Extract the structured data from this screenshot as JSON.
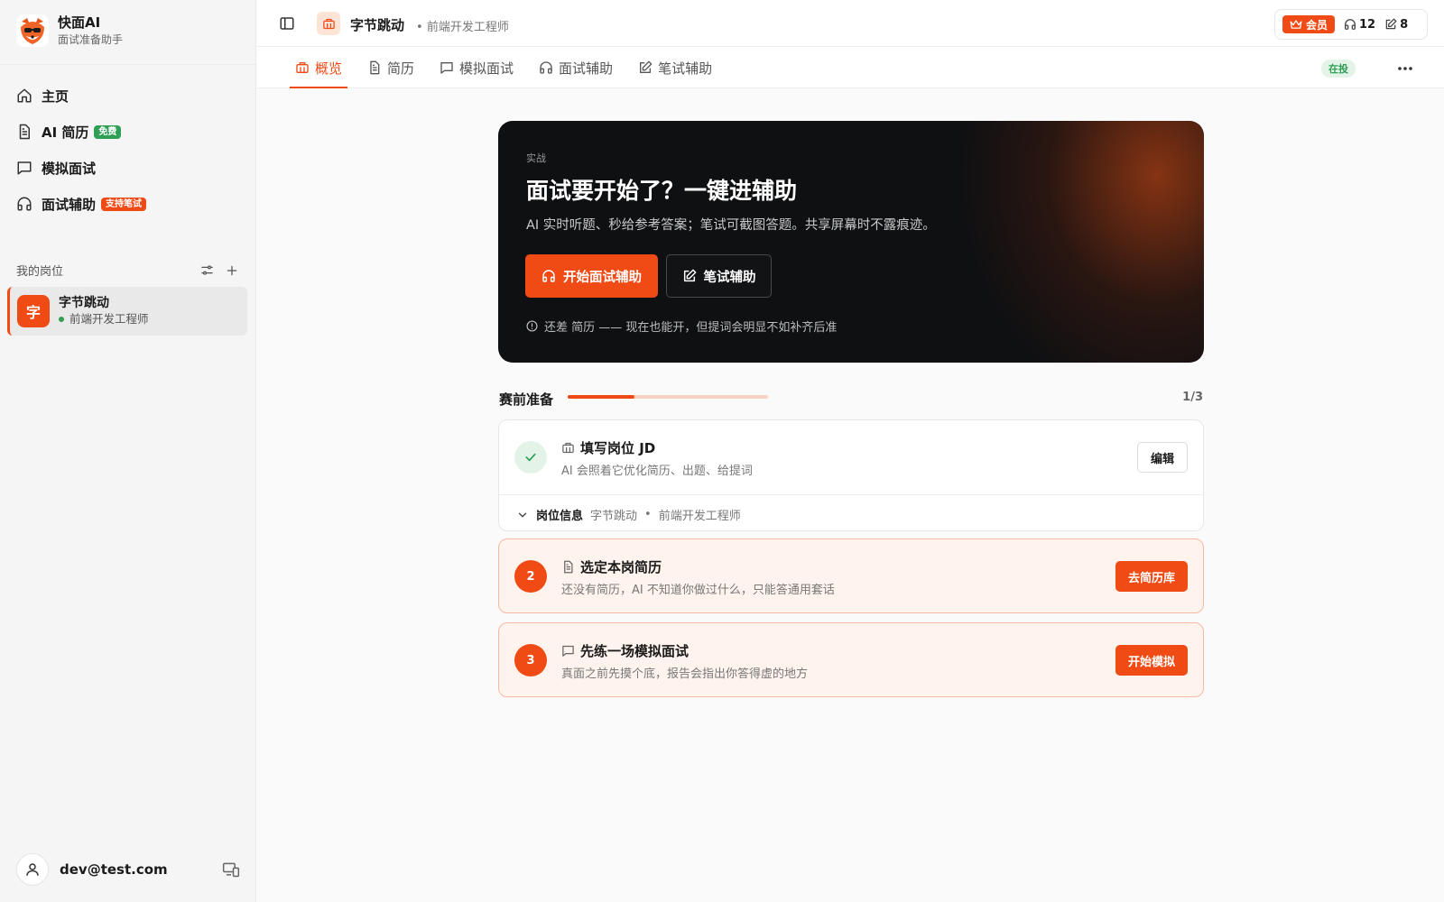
{
  "app": {
    "name": "快面AI",
    "subtitle": "面试准备助手"
  },
  "sidebar": {
    "nav": [
      {
        "label": "主页",
        "icon": "home-icon"
      },
      {
        "label": "AI 简历",
        "icon": "document-icon",
        "badge": "免费",
        "badge_color": "#2e9f55"
      },
      {
        "label": "模拟面试",
        "icon": "chat-bubble-icon"
      },
      {
        "label": "面试辅助",
        "icon": "headphones-icon",
        "badge": "支持笔试",
        "badge_color": "#f04a15"
      }
    ],
    "section_title": "我的岗位",
    "jobs": [
      {
        "avatar": "字",
        "company": "字节跳动",
        "role": "前端开发工程师",
        "status_color": "#2e9f55"
      }
    ],
    "user_email": "dev@test.com"
  },
  "topbar": {
    "company": "字节跳动",
    "role": "前端开发工程师",
    "vip_label": "会员",
    "interview_quota": "12",
    "written_quota": "8"
  },
  "tabs": [
    {
      "label": "概览",
      "icon": "briefcase-icon",
      "active": true
    },
    {
      "label": "简历",
      "icon": "document-icon"
    },
    {
      "label": "模拟面试",
      "icon": "chat-bubble-icon"
    },
    {
      "label": "面试辅助",
      "icon": "headphones-icon"
    },
    {
      "label": "笔试辅助",
      "icon": "edit-icon"
    }
  ],
  "status_pill": "在投",
  "hero": {
    "tag": "实战",
    "title": "面试要开始了？一键进辅助",
    "description": "AI 实时听题、秒给参考答案；笔试可截图答题。共享屏幕时不露痕迹。",
    "primary_button": "开始面试辅助",
    "secondary_button": "笔试辅助",
    "note": "还差 简历 —— 现在也能开，但提词会明显不如补齐后准"
  },
  "prep": {
    "title": "赛前准备",
    "count": "1/3",
    "progress": 0.333
  },
  "steps": [
    {
      "title": "填写岗位 JD",
      "description": "AI 会照着它优化简历、出题、给提词",
      "button": "编辑",
      "done": true,
      "info_label": "岗位信息",
      "info_company": "字节跳动",
      "info_separator": "•",
      "info_role": "前端开发工程师"
    },
    {
      "number": "2",
      "title": "选定本岗简历",
      "description": "还没有简历，AI 不知道你做过什么，只能答通用套话",
      "button": "去简历库"
    },
    {
      "number": "3",
      "title": "先练一场模拟面试",
      "description": "真面之前先摸个底，报告会指出你答得虚的地方",
      "button": "开始模拟"
    }
  ],
  "colors": {
    "accent": "#f04a15",
    "success": "#2e9f55",
    "hero_bg": "#0f1012"
  }
}
